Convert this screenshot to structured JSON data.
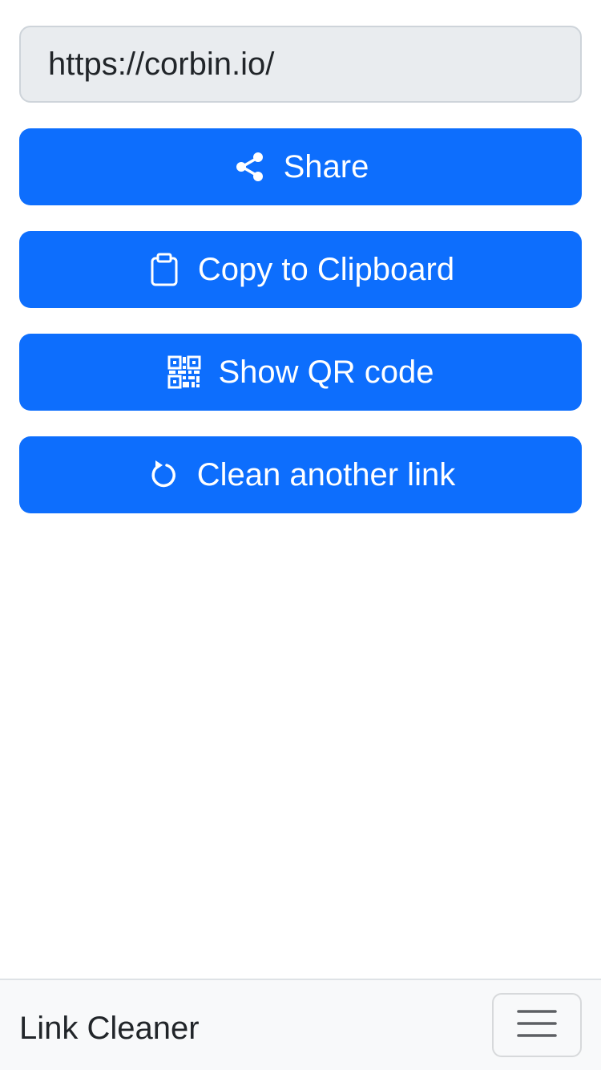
{
  "url_field": {
    "value": "https://corbin.io/"
  },
  "actions": {
    "share": {
      "label": "Share",
      "icon": "share-icon"
    },
    "copy": {
      "label": "Copy to Clipboard",
      "icon": "clipboard-icon"
    },
    "qr": {
      "label": "Show QR code",
      "icon": "qr-code-icon"
    },
    "clean": {
      "label": "Clean another link",
      "icon": "refresh-icon"
    }
  },
  "navbar": {
    "brand": "Link Cleaner",
    "toggler_icon": "hamburger-menu-icon"
  },
  "colors": {
    "primary": "#0d6efd",
    "field_bg": "#e9ecef",
    "navbar_bg": "#f8f9fa"
  }
}
